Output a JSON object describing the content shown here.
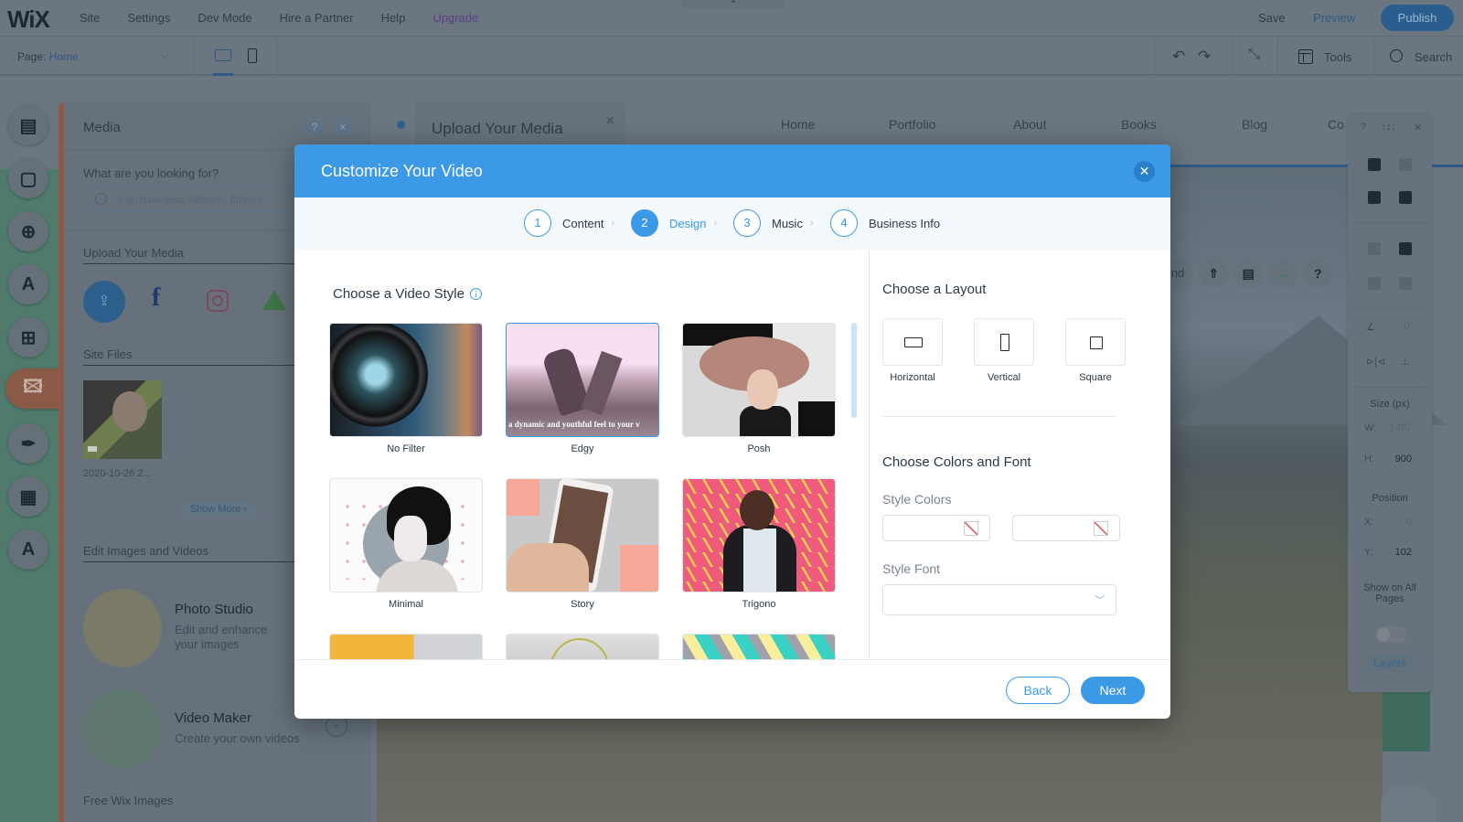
{
  "editor": {
    "logo": "WiX",
    "top_menu": [
      "Site",
      "Settings",
      "Dev Mode",
      "Hire a Partner",
      "Help",
      "Upgrade"
    ],
    "save_label": "Save",
    "preview_label": "Preview",
    "publish_label": "Publish",
    "page_label": "Page:",
    "page_value": "Home",
    "tools_label": "Tools",
    "search_label": "Search"
  },
  "media_panel": {
    "title": "Media",
    "help_icon": "?",
    "close_icon": "×",
    "search_prompt": "What are you looking for?",
    "search_placeholder": "e.g. business, fashion, fitness",
    "upload_section": "Upload Your Media",
    "site_files_section": "Site Files",
    "file_caption": "2020-10-26 2...",
    "show_more": "Show More ›",
    "edit_section": "Edit Images and Videos",
    "tools": [
      {
        "name": "Photo Studio",
        "desc": "Edit and enhance your images"
      },
      {
        "name": "Video Maker",
        "desc": "Create your own videos"
      }
    ],
    "free_images": "Free Wix Images"
  },
  "site": {
    "nav": [
      "Home",
      "Portfolio",
      "About",
      "Books",
      "Blog",
      "Co"
    ],
    "upload_popup": "Upload Your Media",
    "background_pill": "round"
  },
  "right_panel": {
    "size_label": "Size (px)",
    "w_label": "W:",
    "w_value": "1487",
    "h_label": "H:",
    "h_value": "900",
    "position_label": "Position",
    "x_label": "X:",
    "x_value": "0",
    "y_label": "Y:",
    "y_value": "102",
    "rotation_value": "0°",
    "show_all_pages": "Show on All Pages",
    "layers_label": "Layers"
  },
  "modal": {
    "title": "Customize Your Video",
    "steps": [
      {
        "num": "1",
        "label": "Content",
        "active": false
      },
      {
        "num": "2",
        "label": "Design",
        "active": true
      },
      {
        "num": "3",
        "label": "Music",
        "active": false
      },
      {
        "num": "4",
        "label": "Business Info",
        "active": false
      }
    ],
    "video_style_title": "Choose a Video Style",
    "styles": [
      {
        "label": "No Filter"
      },
      {
        "label": "Edgy",
        "caption": "a dynamic and youthful feel to your v"
      },
      {
        "label": "Posh"
      },
      {
        "label": "Minimal"
      },
      {
        "label": "Story"
      },
      {
        "label": "Trigono"
      }
    ],
    "selected_style": "Edgy",
    "layout_title": "Choose a Layout",
    "layouts": [
      "Horizontal",
      "Vertical",
      "Square"
    ],
    "colors_font_title": "Choose Colors and Font",
    "style_colors_label": "Style Colors",
    "style_font_label": "Style Font",
    "style_font_value": "",
    "back_label": "Back",
    "next_label": "Next",
    "accent_color": "#3b99e6"
  }
}
